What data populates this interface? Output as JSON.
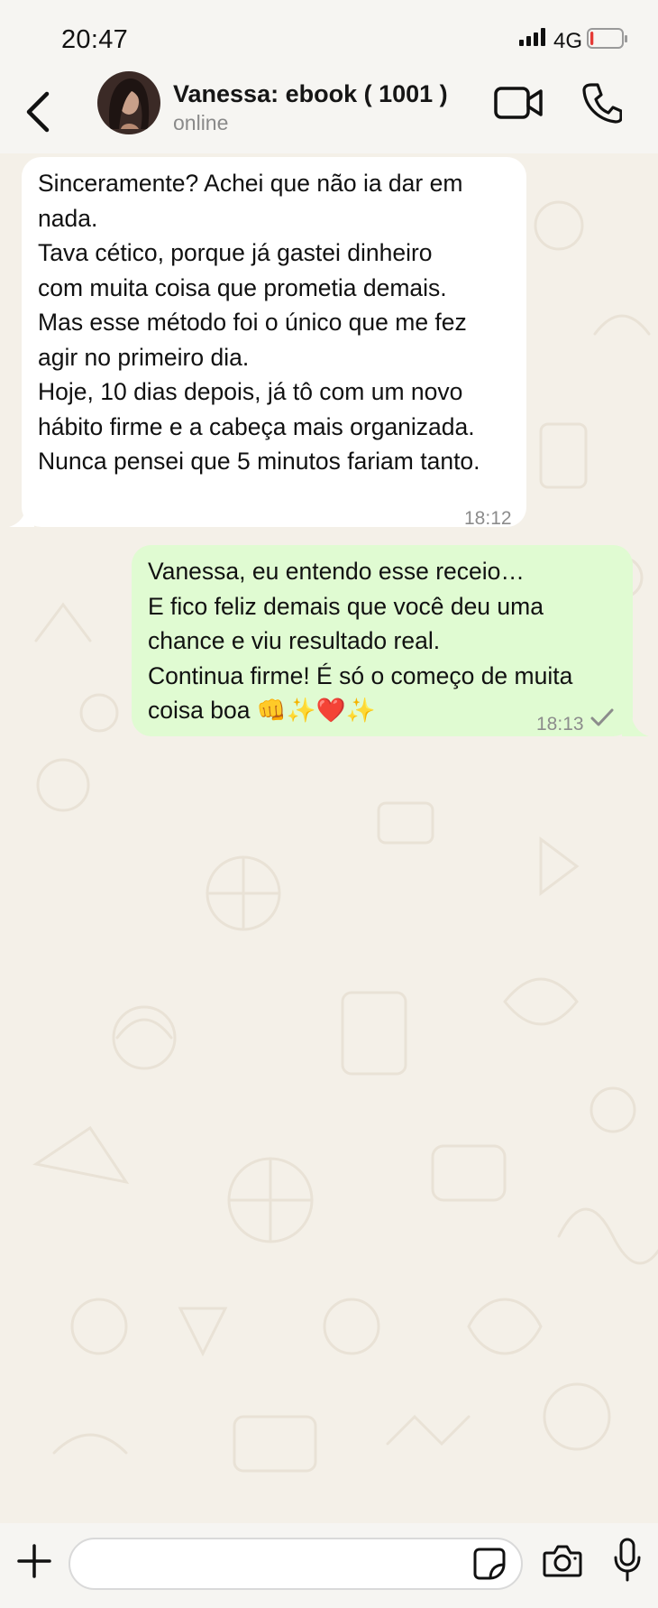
{
  "status_bar": {
    "time": "20:47",
    "network": "4G",
    "battery_level": 0.1,
    "battery_color": "#e53935"
  },
  "header": {
    "back_icon": "chevron-left-icon",
    "contact_name": "Vanessa: ebook ( 1001 )",
    "contact_status": "online",
    "video_icon": "video-camera-icon",
    "call_icon": "phone-icon"
  },
  "messages": [
    {
      "direction": "incoming",
      "text": "Sinceramente? Achei que não ia dar em\nnada.\nTava cético, porque já gastei dinheiro\ncom muita coisa que prometia demais.\nMas esse método foi o único que me fez\nagir no primeiro dia.\nHoje, 10 dias depois, já tô com um novo\nhábito firme e a cabeça mais organizada.\nNunca pensei que 5 minutos fariam tanto.",
      "time": "18:12",
      "bubble_color": "#ffffff"
    },
    {
      "direction": "outgoing",
      "text": "Vanessa, eu entendo esse receio…\nE fico feliz demais que você deu uma\nchance e viu resultado real.\nContinua firme! É só o começo de muita\ncoisa boa 👊✨❤️✨",
      "time": "18:13",
      "status_icon": "single-check-icon",
      "bubble_color": "#e0fbd2"
    }
  ],
  "input_bar": {
    "plus_icon": "plus-icon",
    "placeholder": "",
    "sticker_icon": "sticker-icon",
    "camera_icon": "camera-icon",
    "mic_icon": "microphone-icon"
  }
}
